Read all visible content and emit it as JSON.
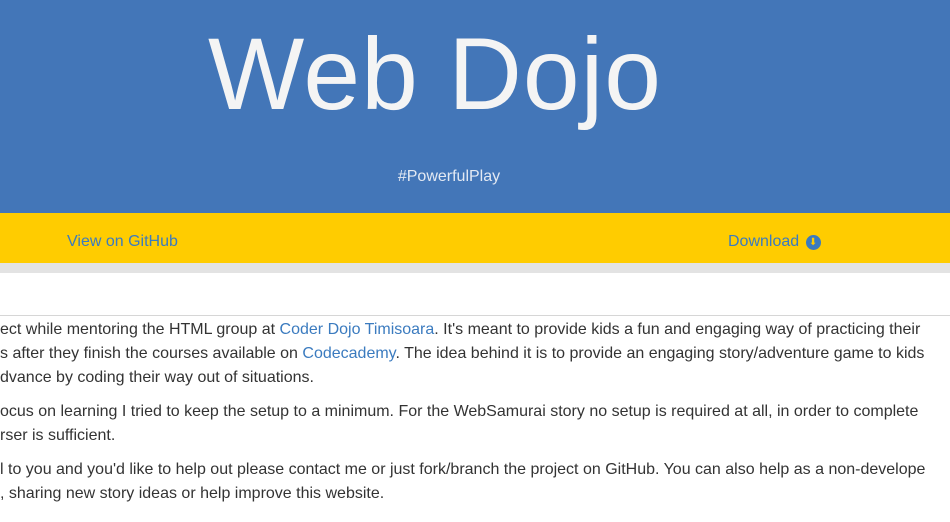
{
  "header": {
    "title": "Web Dojo",
    "tagline": "#PowerfulPlay"
  },
  "actions": {
    "github_label": "View on GitHub",
    "download_label": "Download",
    "download_icon": "arrow-circle-down-icon"
  },
  "content": {
    "p1": {
      "line1_before": "ect while mentoring the HTML group at ",
      "link1": "Coder Dojo Timisoara",
      "line1_after": ". It's meant to provide kids a fun and engaging way of practicing their",
      "line2_before": "s after they finish the courses available on ",
      "link2": "Codecademy",
      "line2_after": ". The idea behind it is to provide an engaging story/adventure game to kids",
      "line3": "dvance by coding their way out of situations."
    },
    "p2": {
      "line1": "ocus on learning I tried to keep the setup to a minimum. For the WebSamurai story no setup is required at all, in order to complete",
      "line2": "rser is sufficient."
    },
    "p3": {
      "line1": "l to you and you'd like to help out please contact me or just fork/branch the project on GitHub. You can also help as a non-develope",
      "line2": ", sharing new story ideas or help improve this website."
    }
  },
  "colors": {
    "hero_bg": "#4376b8",
    "action_bar_bg": "#ffcc00",
    "link": "#3b7bbf"
  }
}
